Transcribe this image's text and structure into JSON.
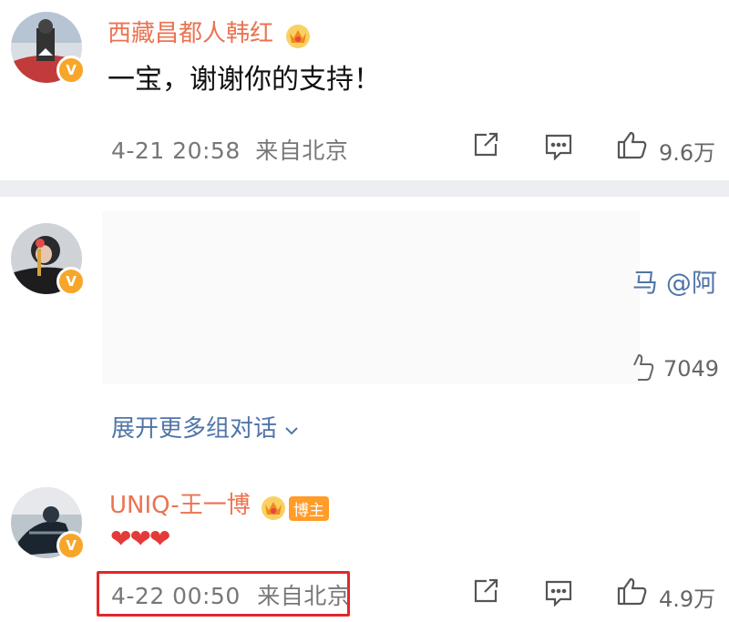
{
  "comments": [
    {
      "username": "西藏昌都人韩红",
      "text": "一宝，谢谢你的支持！",
      "time": "4-21 20:58",
      "location": "来自北京",
      "likes": "9.6万"
    },
    {
      "mention_text": "马 @阿",
      "likes": "7049",
      "expand_label": "展开更多组对话"
    },
    {
      "username": "UNIQ-王一博",
      "badge": "博主",
      "text": "❤❤❤",
      "time": "4-22 00:50",
      "location": "来自北京",
      "likes": "4.9万"
    }
  ],
  "colors": {
    "username": "#eb7350",
    "link": "#5175a8",
    "highlight": "#e4262b",
    "vip_badge": "#f7a62a"
  },
  "icons": [
    "share-icon",
    "comment-icon",
    "like-icon",
    "crown-icon",
    "verified-icon",
    "chevron-down-icon"
  ]
}
